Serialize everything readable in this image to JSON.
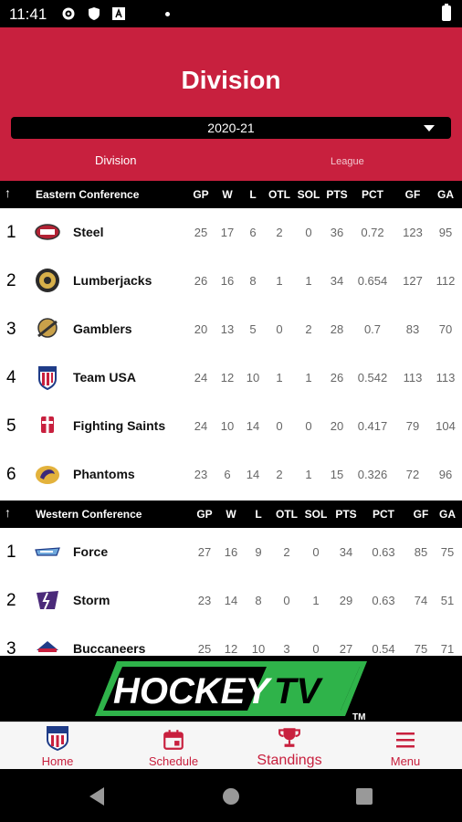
{
  "status_bar": {
    "time": "11:41"
  },
  "header": {
    "title": "Division",
    "season_select": "2020-21",
    "tabs": [
      {
        "label": "Division",
        "active": true
      },
      {
        "label": "League",
        "active": false
      }
    ]
  },
  "columns": [
    "GP",
    "W",
    "L",
    "OTL",
    "SOL",
    "PTS",
    "PCT",
    "GF",
    "GA"
  ],
  "conferences": [
    {
      "name": "Eastern Conference",
      "teams": [
        {
          "rank": "1",
          "name": "Steel",
          "stats": [
            "25",
            "17",
            "6",
            "2",
            "0",
            "36",
            "0.72",
            "123",
            "95"
          ]
        },
        {
          "rank": "2",
          "name": "Lumberjacks",
          "stats": [
            "26",
            "16",
            "8",
            "1",
            "1",
            "34",
            "0.654",
            "127",
            "112"
          ]
        },
        {
          "rank": "3",
          "name": "Gamblers",
          "stats": [
            "20",
            "13",
            "5",
            "0",
            "2",
            "28",
            "0.7",
            "83",
            "70"
          ]
        },
        {
          "rank": "4",
          "name": "Team USA",
          "stats": [
            "24",
            "12",
            "10",
            "1",
            "1",
            "26",
            "0.542",
            "113",
            "113"
          ]
        },
        {
          "rank": "5",
          "name": "Fighting Saints",
          "stats": [
            "24",
            "10",
            "14",
            "0",
            "0",
            "20",
            "0.417",
            "79",
            "104"
          ]
        },
        {
          "rank": "6",
          "name": "Phantoms",
          "stats": [
            "23",
            "6",
            "14",
            "2",
            "1",
            "15",
            "0.326",
            "72",
            "96"
          ]
        }
      ]
    },
    {
      "name": "Western Conference",
      "teams": [
        {
          "rank": "1",
          "name": "Force",
          "stats": [
            "27",
            "16",
            "9",
            "2",
            "0",
            "34",
            "0.63",
            "85",
            "75"
          ]
        },
        {
          "rank": "2",
          "name": "Storm",
          "stats": [
            "23",
            "14",
            "8",
            "0",
            "1",
            "29",
            "0.63",
            "74",
            "51"
          ]
        },
        {
          "rank": "3",
          "name": "Buccaneers",
          "stats": [
            "25",
            "12",
            "10",
            "3",
            "0",
            "27",
            "0.54",
            "75",
            "71"
          ]
        }
      ]
    }
  ],
  "ad_banner": {
    "brand": "HOCKEY TV",
    "word1": "HOCKEY",
    "word2": "TV",
    "tm": "TM"
  },
  "bottom_nav": [
    {
      "label": "Home",
      "icon": "shield-logo-icon"
    },
    {
      "label": "Schedule",
      "icon": "calendar-icon"
    },
    {
      "label": "Standings",
      "icon": "trophy-icon",
      "active": true
    },
    {
      "label": "Menu",
      "icon": "hamburger-menu-icon"
    }
  ],
  "colors": {
    "brand_red": "#c8203e",
    "header_black": "#000000",
    "ad_green": "#2fb34a"
  }
}
